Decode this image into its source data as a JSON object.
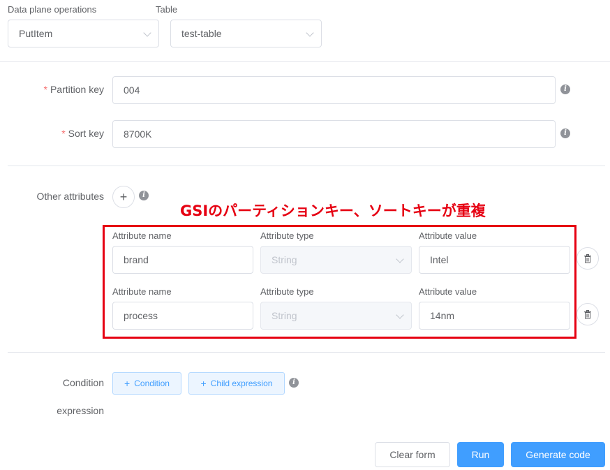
{
  "top": {
    "ops_label": "Data plane operations",
    "ops_value": "PutItem",
    "table_label": "Table",
    "table_value": "test-table"
  },
  "keys": {
    "partition_label": "Partition key",
    "partition_value": "004",
    "sort_label": "Sort key",
    "sort_value": "8700K",
    "required_mark": "*"
  },
  "other_attributes": {
    "label": "Other attributes",
    "rows": [
      {
        "name_label": "Attribute name",
        "name_value": "brand",
        "type_label": "Attribute type",
        "type_value": "String",
        "value_label": "Attribute value",
        "value_value": "Intel"
      },
      {
        "name_label": "Attribute name",
        "name_value": "process",
        "type_label": "Attribute type",
        "type_value": "String",
        "value_label": "Attribute value",
        "value_value": "14nm"
      }
    ]
  },
  "annotation": {
    "text": "GSIのパーティションキー、ソートキーが重複",
    "color": "#e60012"
  },
  "condition": {
    "label_line1": "Condition",
    "label_line2": "expression",
    "condition_btn": "Condition",
    "child_btn": "Child expression"
  },
  "footer": {
    "clear": "Clear form",
    "run": "Run",
    "generate": "Generate code"
  },
  "icons": {
    "info": "i",
    "plus": "+",
    "trash": "trash-icon",
    "chevron": "chevron-down-icon"
  },
  "colors": {
    "primary": "#409eff",
    "required": "#f56c6c",
    "border": "#dcdfe6"
  }
}
